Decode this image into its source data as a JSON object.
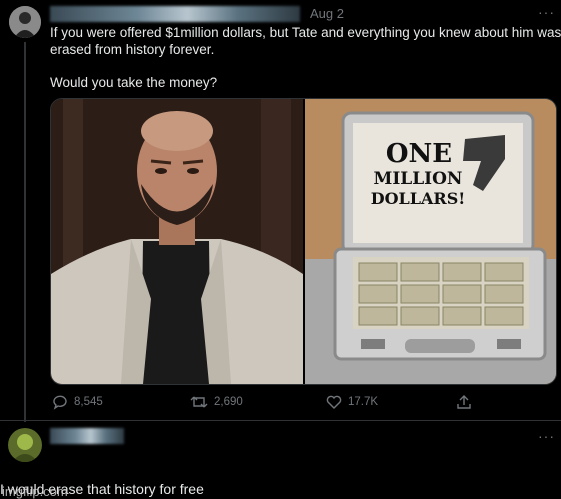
{
  "tweet": {
    "date": "Aug 2",
    "more": "···",
    "text_line1": "If you were offered $1million dollars, but Tate and everything you knew about him was",
    "text_line2": "erased from history forever.",
    "text_line3": "Would you take the money?",
    "briefcase": {
      "line1": "ONE",
      "line2": "MILLION",
      "line3": "DOLLARS!"
    },
    "actions": {
      "replies": "8,545",
      "retweets": "2,690",
      "likes": "17.7K"
    }
  },
  "reply": {
    "more": "···",
    "text": "I would erase that history for free"
  },
  "watermark": "imgflip.com"
}
